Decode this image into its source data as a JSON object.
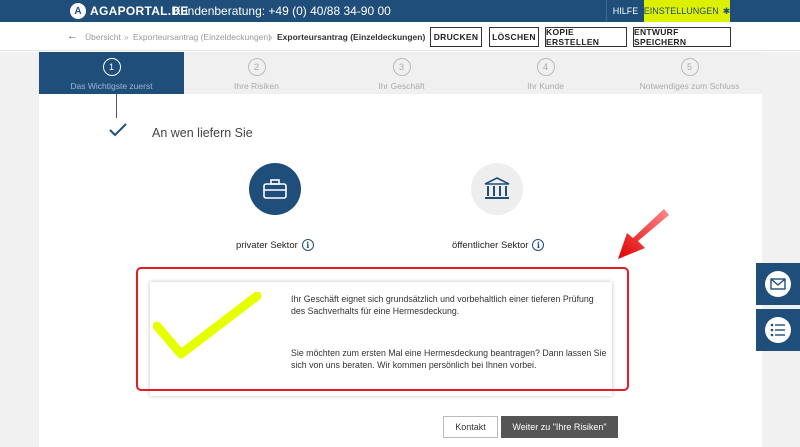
{
  "header": {
    "logo_mark": "A",
    "logo_text": "AGAPORTAL.DE",
    "hotline": "Kundenberatung: +49 (0) 40/88 34-90 00",
    "help": "HILFE",
    "settings": "EINSTELLUNGEN",
    "settings_icon": "gear-icon"
  },
  "breadcrumb": {
    "items": [
      "Übersicht",
      "Exporteursantrag (Einzeldeckungen)",
      "Exporteursantrag (Einzeldeckungen)"
    ],
    "separator": "»"
  },
  "toolbar": {
    "print": "DRUCKEN",
    "delete": "LÖSCHEN",
    "copy": "KOPIE ERSTELLEN",
    "save_draft": "ENTWURF SPEICHERN"
  },
  "steps": [
    {
      "num": "1",
      "label": "Das Wichtigste zuerst"
    },
    {
      "num": "2",
      "label": "Ihre Risiken"
    },
    {
      "num": "3",
      "label": "Ihr Geschäft"
    },
    {
      "num": "4",
      "label": "Ihr Kunde"
    },
    {
      "num": "5",
      "label": "Notwendiges zum Schluss"
    }
  ],
  "section": {
    "title": "An wen liefern Sie"
  },
  "sectors": {
    "private": "privater Sektor",
    "public": "öffentlicher Sektor",
    "info_glyph": "i"
  },
  "result": {
    "line1": "Ihr Geschäft eignet sich grundsätzlich und vorbehaltlich einer tieferen Prüfung",
    "line2": "des Sachverhalts für eine Hermesdeckung.",
    "line3": "Sie möchten zum ersten Mal eine Hermesdeckung beantragen? Dann lassen Sie",
    "line4": "sich von uns beraten. Wir kommen persönlich bei Ihnen vorbei."
  },
  "actions": {
    "contact": "Kontakt",
    "next": "Weiter zu \"Ihre Risiken\""
  },
  "colors": {
    "primary": "#1f4e7a",
    "accent": "#dcf000",
    "highlight_red": "#e31d24",
    "check_yellow": "#e6ff00"
  }
}
